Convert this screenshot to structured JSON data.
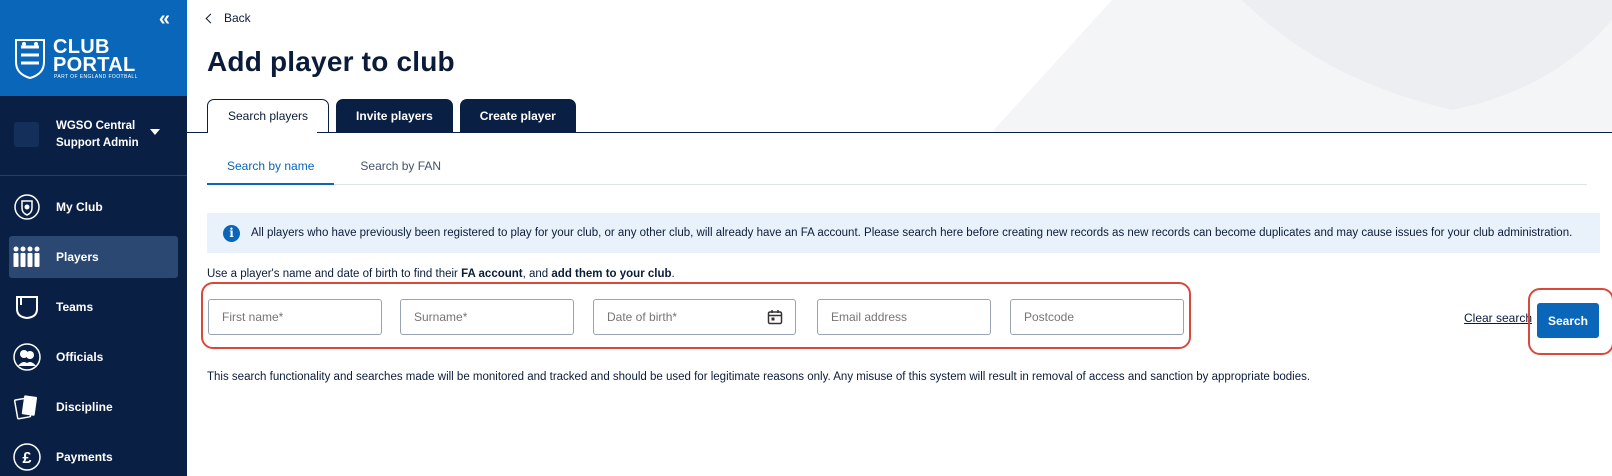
{
  "sidebar": {
    "collapse_glyph": "«",
    "logo_line1": "CLUB",
    "logo_line2": "PORTAL",
    "logo_sub": "PART OF ENGLAND FOOTBALL",
    "account_line1": "WGSO Central",
    "account_line2": "Support Admin",
    "items": [
      {
        "label": "My Club",
        "icon": "shield-icon"
      },
      {
        "label": "Players",
        "icon": "players-icon",
        "active": true
      },
      {
        "label": "Teams",
        "icon": "kit-icon"
      },
      {
        "label": "Officials",
        "icon": "officials-icon"
      },
      {
        "label": "Discipline",
        "icon": "cards-icon"
      },
      {
        "label": "Payments",
        "icon": "pound-icon"
      }
    ]
  },
  "header": {
    "back_label": "Back",
    "title": "Add player to club"
  },
  "tabs": [
    {
      "label": "Search players",
      "selected": true
    },
    {
      "label": "Invite players"
    },
    {
      "label": "Create player"
    }
  ],
  "subtabs": [
    {
      "label": "Search by name",
      "active": true
    },
    {
      "label": "Search by FAN"
    }
  ],
  "info_banner": {
    "icon": "info-icon",
    "text": "All players who have previously been registered to play for your club, or any other club, will already have an FA account. Please search here before creating new records as new records can become duplicates and may cause issues for your club administration."
  },
  "hint": {
    "part1": "Use a player's name and date of birth to find their ",
    "bold1": "FA account",
    "part2": ", and ",
    "bold2": "add them to your club",
    "part3": "."
  },
  "fields": {
    "first_name": "First name*",
    "surname": "Surname*",
    "dob": "Date of birth*",
    "email": "Email address",
    "postcode": "Postcode"
  },
  "actions": {
    "clear": "Clear search",
    "search": "Search"
  },
  "disclaimer": "This search functionality and searches made will be monitored and tracked and should be used for legitimate reasons only. Any misuse of this system will result in removal of access and sanction by appropriate bodies.",
  "colors": {
    "sidebar_bg": "#0a1f44",
    "brand_blue": "#0a66b8",
    "highlight_red": "#d9493b"
  }
}
